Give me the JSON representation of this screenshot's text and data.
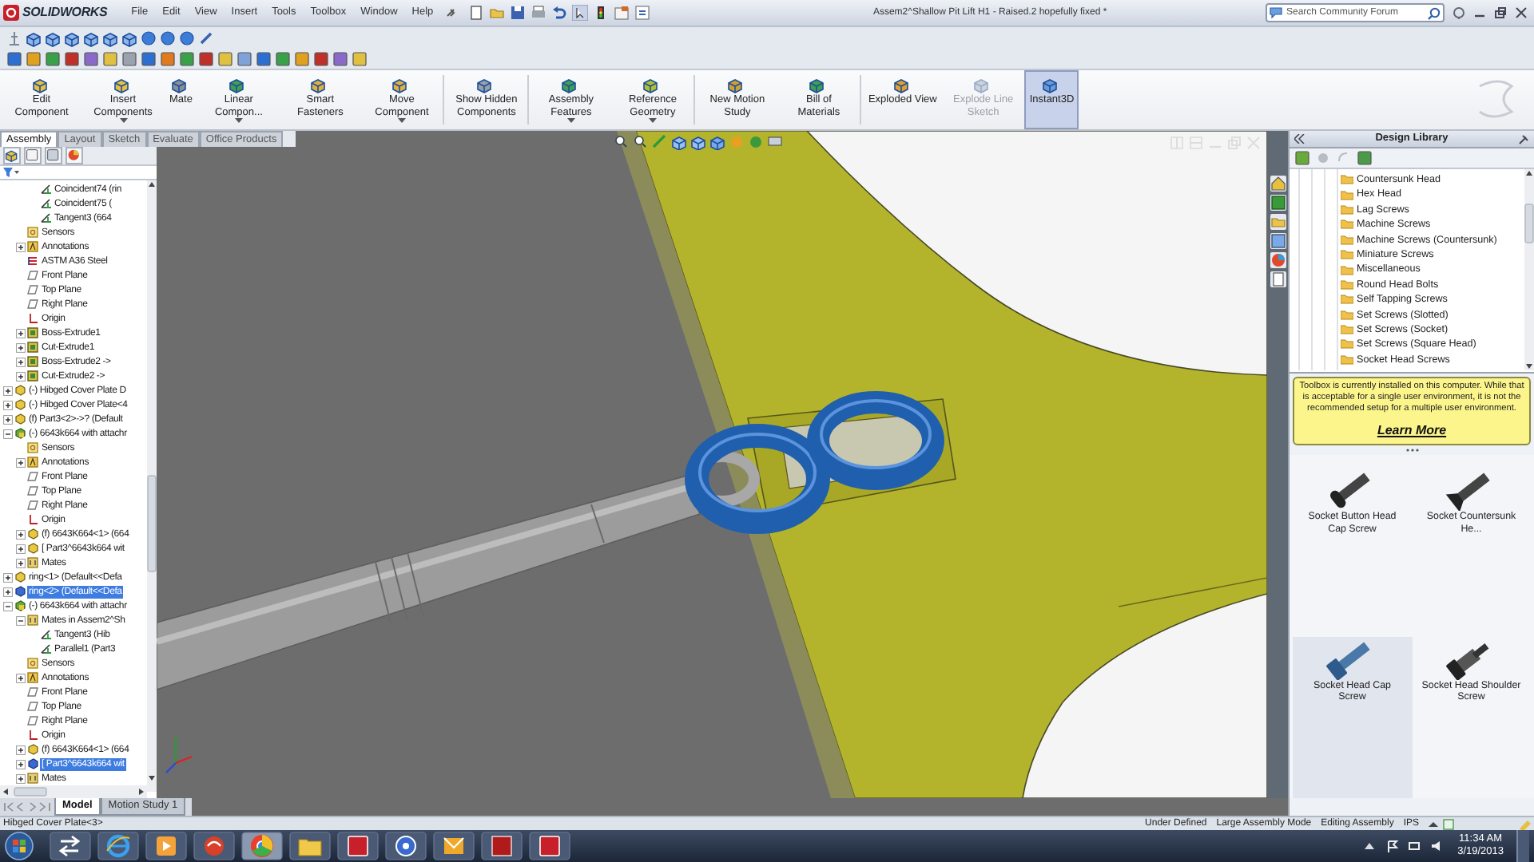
{
  "app": {
    "logo": "SOLIDWORKS",
    "menu": [
      "File",
      "Edit",
      "View",
      "Insert",
      "Tools",
      "Toolbox",
      "Window",
      "Help"
    ],
    "title": "Assem2^Shallow Pit Lift H1 - Raised.2 hopefully fixed *",
    "search": {
      "placeholder": "Search Community Forum"
    }
  },
  "command_manager": [
    {
      "label": "Edit Component",
      "dropdown": false,
      "disabled": false,
      "on": false
    },
    {
      "label": "Insert Components",
      "dropdown": true,
      "disabled": false,
      "on": false
    },
    {
      "label": "Mate",
      "dropdown": false,
      "disabled": false,
      "on": false
    },
    {
      "label": "Linear Compon...",
      "dropdown": true,
      "disabled": false,
      "on": false
    },
    {
      "label": "Smart Fasteners",
      "dropdown": false,
      "disabled": false,
      "on": false
    },
    {
      "label": "Move Component",
      "dropdown": true,
      "disabled": false,
      "on": false
    },
    {
      "label": "Show Hidden Components",
      "dropdown": false,
      "disabled": false,
      "on": false
    },
    {
      "label": "Assembly Features",
      "dropdown": true,
      "disabled": false,
      "on": false
    },
    {
      "label": "Reference Geometry",
      "dropdown": true,
      "disabled": false,
      "on": false
    },
    {
      "label": "New Motion Study",
      "dropdown": false,
      "disabled": false,
      "on": false
    },
    {
      "label": "Bill of Materials",
      "dropdown": false,
      "disabled": false,
      "on": false
    },
    {
      "label": "Exploded View",
      "dropdown": false,
      "disabled": false,
      "on": false
    },
    {
      "label": "Explode Line Sketch",
      "dropdown": false,
      "disabled": true,
      "on": false
    },
    {
      "label": "Instant3D",
      "dropdown": false,
      "disabled": false,
      "on": true
    }
  ],
  "tabs": [
    {
      "label": "Assembly",
      "selected": true
    },
    {
      "label": "Layout",
      "selected": false
    },
    {
      "label": "Sketch",
      "selected": false
    },
    {
      "label": "Evaluate",
      "selected": false
    },
    {
      "label": "Office Products",
      "selected": false
    }
  ],
  "feature_tree": {
    "items": [
      {
        "children": [
          {
            "children": [
              {
                "kind": "mate",
                "label": "Coincident74 (rin",
                "selected": false
              },
              {
                "kind": "mate",
                "label": "Coincident75 (",
                "selected": false
              },
              {
                "kind": "mate",
                "label": "Tangent3 (664",
                "selected": false
              }
            ]
          },
          {
            "kind": "sensors",
            "label": "Sensors",
            "selected": false
          },
          {
            "kind": "annotations",
            "label": "Annotations",
            "expanded": false,
            "selected": false
          },
          {
            "kind": "material",
            "label": "ASTM A36 Steel",
            "selected": false
          },
          {
            "kind": "plane",
            "label": "Front Plane",
            "selected": false
          },
          {
            "kind": "plane",
            "label": "Top Plane",
            "selected": false
          },
          {
            "kind": "plane",
            "label": "Right Plane",
            "selected": false
          },
          {
            "kind": "origin",
            "label": "Origin",
            "selected": false
          },
          {
            "kind": "feature",
            "label": "Boss-Extrude1",
            "expanded": false,
            "selected": false
          },
          {
            "kind": "feature",
            "label": "Cut-Extrude1",
            "expanded": false,
            "selected": false
          },
          {
            "kind": "feature",
            "label": "Boss-Extrude2 ->",
            "expanded": false,
            "selected": false
          },
          {
            "kind": "feature",
            "label": "Cut-Extrude2 ->",
            "expanded": false,
            "selected": false
          }
        ]
      },
      {
        "kind": "part",
        "label": "(-) Hibged Cover Plate D",
        "expanded": false,
        "selected": false
      },
      {
        "kind": "part",
        "label": "(-) Hibged Cover Plate<4",
        "expanded": false,
        "selected": false
      },
      {
        "kind": "part",
        "label": "(f) Part3<2>->? (Default",
        "expanded": false,
        "selected": false
      },
      {
        "kind": "assembly",
        "label": "(-) 6643k664 with attachr",
        "expanded": true,
        "selected": false,
        "children": [
          {
            "kind": "sensors",
            "label": "Sensors",
            "selected": false
          },
          {
            "kind": "annotations",
            "label": "Annotations",
            "expanded": false,
            "selected": false
          },
          {
            "kind": "plane",
            "label": "Front Plane",
            "selected": false
          },
          {
            "kind": "plane",
            "label": "Top Plane",
            "selected": false
          },
          {
            "kind": "plane",
            "label": "Right Plane",
            "selected": false
          },
          {
            "kind": "origin",
            "label": "Origin",
            "selected": false
          },
          {
            "kind": "part",
            "label": "(f) 6643K664<1> (664",
            "expanded": false,
            "selected": false
          },
          {
            "kind": "part",
            "label": "[ Part3^6643k664 wit",
            "expanded": false,
            "selected": false
          },
          {
            "kind": "mates",
            "label": "Mates",
            "expanded": false,
            "selected": false
          }
        ]
      },
      {
        "kind": "part",
        "label": "ring<1> (Default<<Defa",
        "expanded": false,
        "selected": false
      },
      {
        "kind": "part",
        "label": "ring<2> (Default<<Defa",
        "expanded": false,
        "selected": true
      },
      {
        "kind": "assembly",
        "label": "(-) 6643k664 with attachr",
        "expanded": true,
        "selected": false,
        "children": [
          {
            "kind": "mates",
            "label": "Mates in Assem2^Sh",
            "expanded": true,
            "selected": false,
            "children": [
              {
                "kind": "mate",
                "label": "Tangent3 (Hib",
                "selected": false
              },
              {
                "kind": "mate",
                "label": "Parallel1 (Part3",
                "selected": false
              }
            ]
          },
          {
            "kind": "sensors",
            "label": "Sensors",
            "selected": false
          },
          {
            "kind": "annotations",
            "label": "Annotations",
            "expanded": false,
            "selected": false
          },
          {
            "kind": "plane",
            "label": "Front Plane",
            "selected": false
          },
          {
            "kind": "plane",
            "label": "Top Plane",
            "selected": false
          },
          {
            "kind": "plane",
            "label": "Right Plane",
            "selected": false
          },
          {
            "kind": "origin",
            "label": "Origin",
            "selected": false
          },
          {
            "kind": "part",
            "label": "(f) 6643K664<1> (664",
            "expanded": false,
            "selected": false
          },
          {
            "kind": "part",
            "label": "[ Part3^6643k664 wit",
            "expanded": false,
            "selected": true
          },
          {
            "kind": "mates",
            "label": "Mates",
            "expanded": false,
            "selected": false
          }
        ]
      }
    ]
  },
  "design_library": {
    "title": "Design Library",
    "folders": [
      "Countersunk Head",
      "Hex Head",
      "Lag Screws",
      "Machine Screws",
      "Machine Screws (Countersunk)",
      "Miniature Screws",
      "Miscellaneous",
      "Round Head Bolts",
      "Self Tapping Screws",
      "Set Screws (Slotted)",
      "Set Screws (Socket)",
      "Set Screws (Square Head)",
      "Socket Head Screws"
    ],
    "notice": {
      "text": "Toolbox is currently installed on this computer. While that is acceptable for a single user environment, it is not the recommended setup for a multiple user environment.",
      "link": "Learn More"
    },
    "parts": [
      {
        "kind": "button",
        "label": "Socket Button Head Cap Screw",
        "selected": false
      },
      {
        "kind": "countersunk",
        "label": "Socket Countersunk He...",
        "selected": false
      },
      {
        "kind": "cap",
        "label": "Socket Head Cap Screw",
        "selected": true
      },
      {
        "kind": "shoulder",
        "label": "Socket Head Shoulder Screw",
        "selected": false
      }
    ]
  },
  "bottom_tabs": [
    {
      "label": "Model",
      "selected": true
    },
    {
      "label": "Motion Study 1",
      "selected": false
    }
  ],
  "status_bar": {
    "left": "Hibged Cover Plate<3>",
    "fields": [
      "Under Defined",
      "Large Assembly Mode",
      "Editing Assembly",
      "IPS"
    ]
  },
  "taskbar": {
    "time": "11:34 AM",
    "date": "3/19/2013"
  }
}
